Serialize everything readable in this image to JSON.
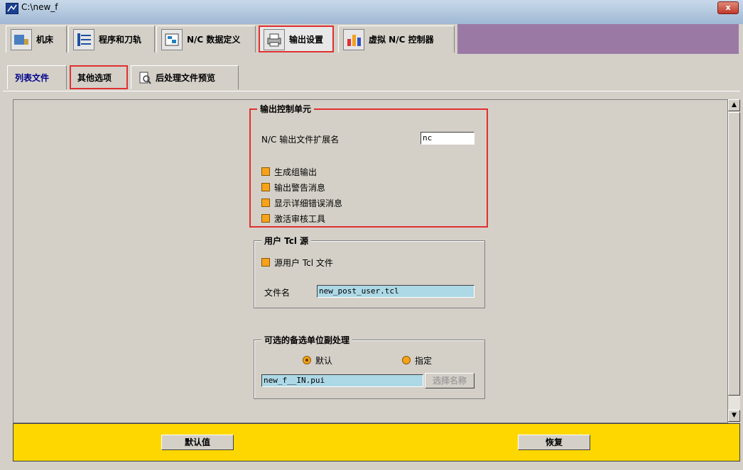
{
  "window": {
    "title": "C:\\new_f",
    "close_label": "x"
  },
  "top_tabs": [
    {
      "label": "机床",
      "icon": "machine-icon"
    },
    {
      "label": "程序和刀轨",
      "icon": "program-icon"
    },
    {
      "label": "N/C 数据定义",
      "icon": "data-definition-icon"
    },
    {
      "label": "输出设置",
      "icon": "printer-icon"
    },
    {
      "label": "虚拟 N/C 控制器",
      "icon": "virtual-controller-icon"
    }
  ],
  "sub_tabs": [
    {
      "label": "列表文件"
    },
    {
      "label": "其他选项"
    },
    {
      "label": "后处理文件预览",
      "icon": "preview-icon"
    }
  ],
  "output_control": {
    "legend": "输出控制单元",
    "ext_label": "N/C 输出文件扩展名",
    "ext_value": "nc",
    "options": [
      "生成组输出",
      "输出警告消息",
      "显示详细错误消息",
      "激活审核工具"
    ]
  },
  "user_tcl": {
    "legend": "用户 Tcl 源",
    "source_label": "源用户 Tcl 文件",
    "file_label": "文件名",
    "file_value": "new_post_user.tcl"
  },
  "alt_unit": {
    "legend": "可选的备选单位副处理",
    "radio_default": "默认",
    "radio_specify": "指定",
    "file_value": "new_f__IN.pui",
    "select_button": "选择名称"
  },
  "footer": {
    "default_button": "默认值",
    "restore_button": "恢复"
  },
  "colors": {
    "checkbox": "#f7a21b",
    "footer": "#ffd700",
    "highlight": "#e03030",
    "tab_bg": "#9a7aa5"
  }
}
